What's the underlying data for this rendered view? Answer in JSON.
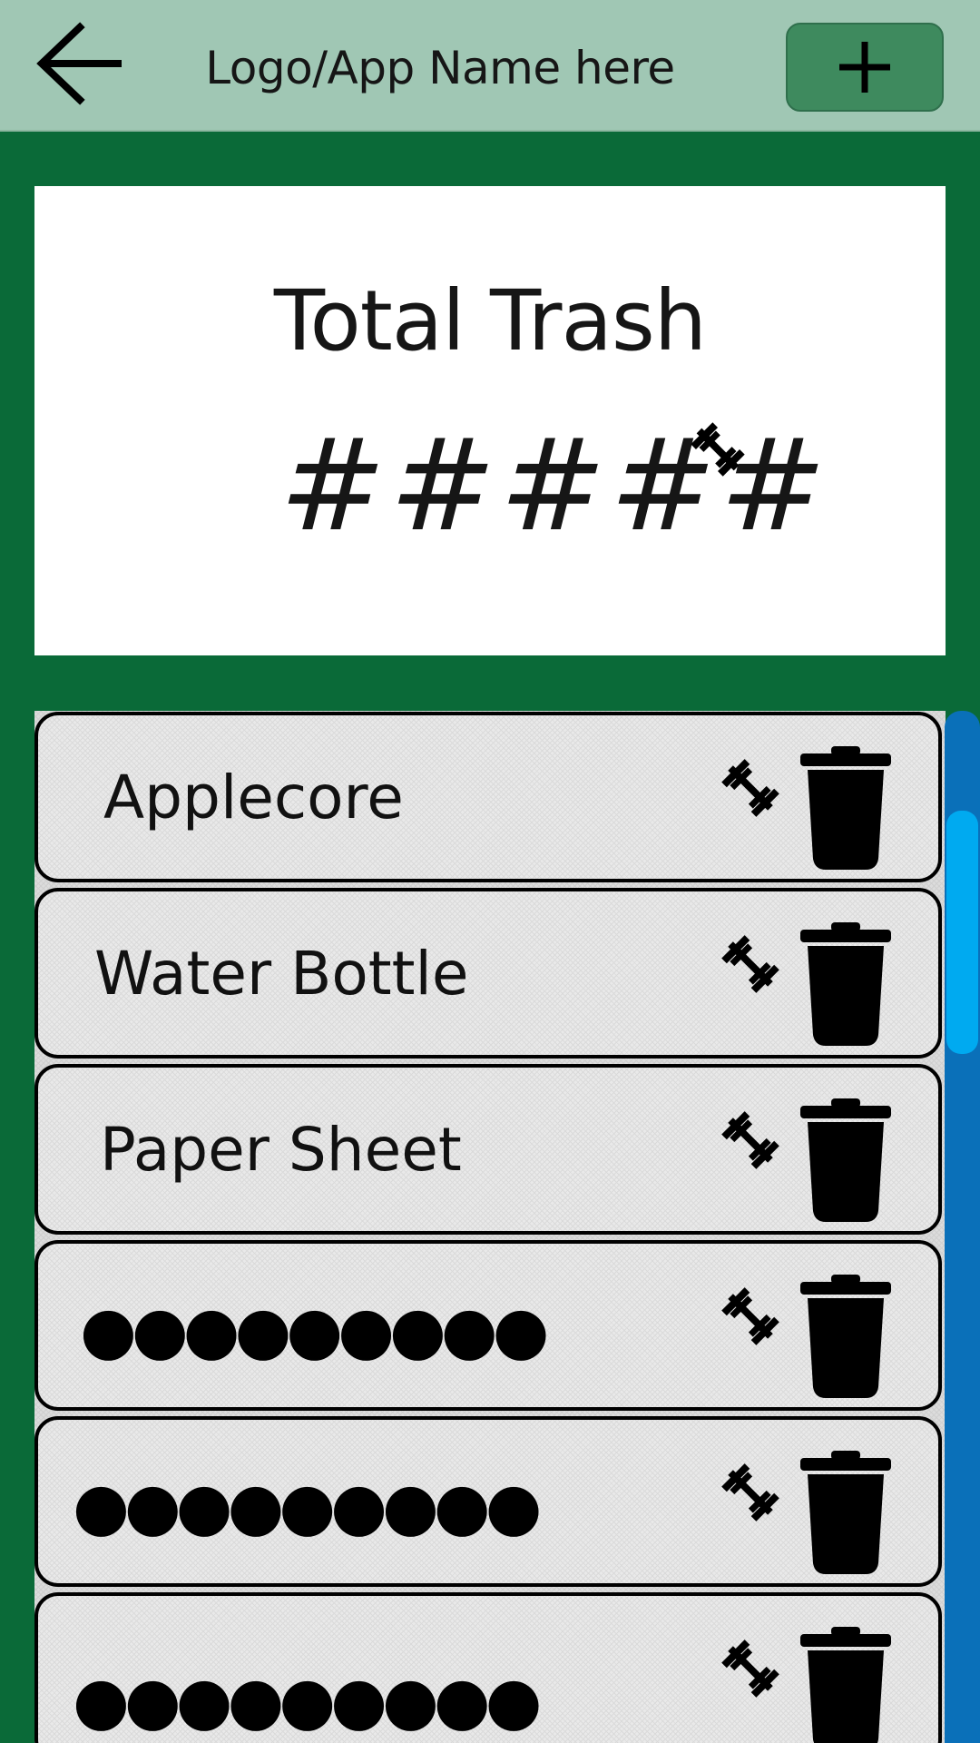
{
  "header": {
    "title": "Logo/App Name here",
    "back_icon": "arrow-left-icon",
    "add_icon": "plus-icon"
  },
  "total": {
    "title": "Total Trash",
    "value": "#####",
    "unit_icon": "dumbbell-icon"
  },
  "items": [
    {
      "label": "Applecore",
      "weight_icon": "dumbbell-icon",
      "delete_icon": "trash-icon"
    },
    {
      "label": "Water Bottle",
      "weight_icon": "dumbbell-icon",
      "delete_icon": "trash-icon"
    },
    {
      "label": "Paper Sheet",
      "weight_icon": "dumbbell-icon",
      "delete_icon": "trash-icon"
    },
    {
      "label": "●●●●●●●●●",
      "weight_icon": "dumbbell-icon",
      "delete_icon": "trash-icon"
    },
    {
      "label": "●●●●●●●●●",
      "weight_icon": "dumbbell-icon",
      "delete_icon": "trash-icon"
    },
    {
      "label": "●●●●●●●●●",
      "weight_icon": "dumbbell-icon",
      "delete_icon": "trash-icon"
    }
  ],
  "colors": {
    "header_bg": "#a0c7b4",
    "background": "#0a6a38",
    "add_button": "#3e8a5e",
    "scroll_track": "#0a70b9",
    "scroll_thumb": "#00aaf0"
  }
}
